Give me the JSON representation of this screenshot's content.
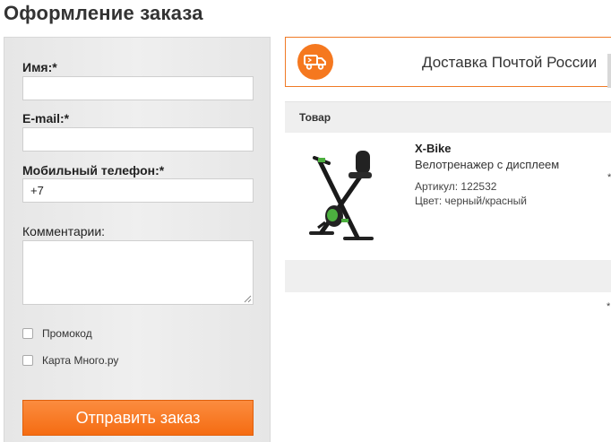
{
  "page": {
    "title": "Оформление заказа"
  },
  "form": {
    "name_label": "Имя:*",
    "name_value": "",
    "email_label": "E-mail:*",
    "email_value": "",
    "phone_label": "Мобильный телефон:*",
    "phone_value": "+7",
    "comment_label": "Комментарии:",
    "comment_value": "",
    "promo_label": "Промокод",
    "card_label": "Карта Много.ру",
    "submit_label": "Отправить заказ"
  },
  "delivery": {
    "icon": "truck-icon",
    "label": "Доставка Почтой России"
  },
  "cart": {
    "column_header": "Товар",
    "product": {
      "name": "X-Bike",
      "description": "Велотренажер с дисплеем",
      "article": "Артикул: 122532",
      "color": "Цвет: черный/красный"
    },
    "cut_marks": [
      "*",
      "*"
    ]
  },
  "colors": {
    "accent": "#f5781f",
    "button_top": "#fb8c3f",
    "button_bottom": "#f56c12"
  }
}
